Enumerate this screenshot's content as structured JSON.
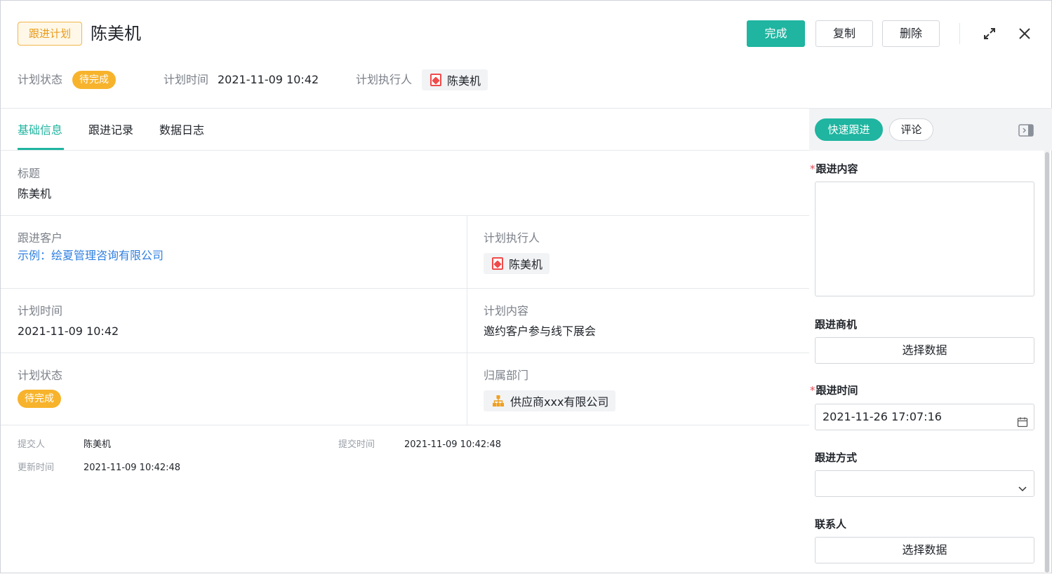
{
  "header": {
    "type_badge": "跟进计划",
    "title": "陈美机",
    "buttons": {
      "complete": "完成",
      "copy": "复制",
      "delete": "删除"
    },
    "meta": {
      "status_label": "计划状态",
      "status_value": "待完成",
      "time_label": "计划时间",
      "time_value": "2021-11-09 10:42",
      "executor_label": "计划执行人",
      "executor_value": "陈美机"
    }
  },
  "tabs": [
    {
      "label": "基础信息",
      "active": true
    },
    {
      "label": "跟进记录",
      "active": false
    },
    {
      "label": "数据日志",
      "active": false
    }
  ],
  "fields": {
    "title_label": "标题",
    "title_value": "陈美机",
    "customer_label": "跟进客户",
    "customer_value": "示例：绘夏管理咨询有限公司",
    "executor_label": "计划执行人",
    "executor_value": "陈美机",
    "plan_time_label": "计划时间",
    "plan_time_value": "2021-11-09 10:42",
    "plan_content_label": "计划内容",
    "plan_content_value": "邀约客户参与线下展会",
    "plan_status_label": "计划状态",
    "plan_status_value": "待完成",
    "department_label": "归属部门",
    "department_value": "供应商xxx有限公司"
  },
  "footer_meta": {
    "submitter_label": "提交人",
    "submitter_value": "陈美机",
    "submit_time_label": "提交时间",
    "submit_time_value": "2021-11-09 10:42:48",
    "update_time_label": "更新时间",
    "update_time_value": "2021-11-09 10:42:48"
  },
  "panel": {
    "tabs": {
      "quick_follow": "快速跟进",
      "comment": "评论"
    },
    "content_label": "跟进内容",
    "opportunity_label": "跟进商机",
    "select_data": "选择数据",
    "follow_time_label": "跟进时间",
    "follow_time_value": "2021-11-26 17:07:16",
    "method_label": "跟进方式",
    "contact_label": "联系人"
  },
  "colors": {
    "accent": "#1fb5a0",
    "status": "#f7b32b",
    "link": "#2f7fe0",
    "required": "#e34d59"
  }
}
